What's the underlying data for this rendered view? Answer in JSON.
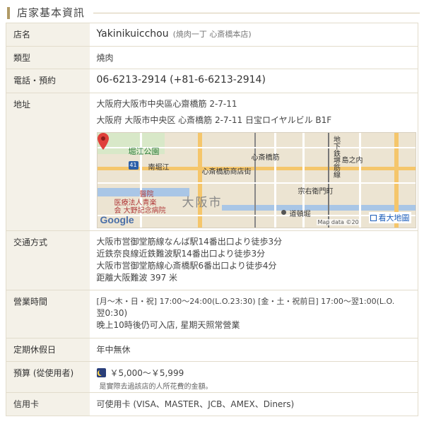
{
  "section": {
    "title": "店家基本資訊"
  },
  "rows": {
    "name": {
      "label": "店名",
      "value": "Yakinikuicchou",
      "sub": "(焼肉一丁 心斎橋本店)"
    },
    "type": {
      "label": "類型",
      "value": "燒肉"
    },
    "tel": {
      "label": "電話・預約",
      "value": "06-6213-2914 (+81-6-6213-2914)"
    },
    "address": {
      "label": "地址",
      "line1": "大阪府大阪市中央區心齋橋筋 2-7-11",
      "line2": "大阪府 大阪市中央区 心斎橋筋 2-7-11 日宝ロイヤルビル B1F"
    },
    "access": {
      "label": "交通方式",
      "lines": [
        "大阪市営御堂筋線なんば駅14番出口より徒歩3分",
        "近鉄奈良線近鉄難波駅14番出口より徒歩3分",
        "大阪市営御堂筋線心斎橋駅6番出口より徒歩4分",
        "距離大阪難波 397 米"
      ]
    },
    "hours": {
      "label": "營業時間",
      "line1": "[月～木・日・祝] 17:00～24:00(L.O.23:30) [金・土・祝前日] 17:00～翌1:00(L.O.",
      "line2": "翌0:30)",
      "line3": "晚上10時後仍可入店, 星期天照常營業"
    },
    "closed": {
      "label": "定期休假日",
      "value": "年中無休"
    },
    "budget": {
      "label": "預算 (從使用者)",
      "value": "￥5,000～￥5,999",
      "note": "是實際去過該店的人所花費的金額。"
    },
    "card": {
      "label": "信用卡",
      "value": "可使用卡 (VISA、MASTER、JCB、AMEX、Diners)"
    }
  },
  "map": {
    "labels": {
      "park": "堀江公園",
      "minami_horie": "南堀江",
      "shinsaibashi_suji": "心斎橋筋",
      "shopping_street": "心斎橋筋商店街",
      "subway_line": "地下鉄堺筋線",
      "shimanouchi": "島之内",
      "soemon": "宗右衛門町",
      "hospital": "醫院",
      "hospital_name_1": "医療法人青楽",
      "hospital_name_2": "会 大野記念病院",
      "osaka": "大阪市",
      "dotonbori": "道頓堀",
      "route": "41",
      "google": "Google",
      "credit": "Map data ©20",
      "enlarge": "看大地圖"
    },
    "icons": [
      "map-pin-icon",
      "park-icon",
      "hospital-icon",
      "station-icon",
      "expand-icon"
    ]
  }
}
